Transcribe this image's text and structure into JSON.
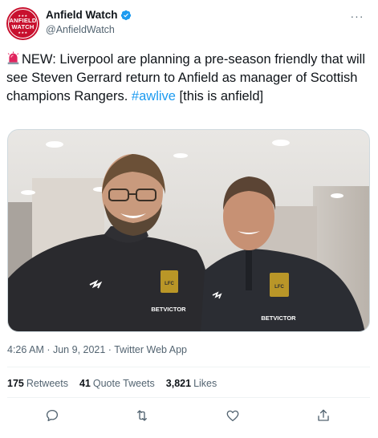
{
  "author": {
    "display_name": "Anfield Watch",
    "handle": "@AnfieldWatch",
    "avatar_text_top": "ANFIELD",
    "avatar_text_bottom": "WATCH",
    "avatar_color": "#c8102e",
    "verified_icon": "verified-badge-icon"
  },
  "tweet": {
    "prefix": "NEW: Liverpool are planning a pre-season friendly that will see Steven Gerrard return to Anfield as manager of Scottish champions Rangers. ",
    "hashtag": "#awlive",
    "suffix": " [this is anfield]",
    "emoji_icon": "police-siren-icon"
  },
  "photo": {
    "kind": "photo-two-men-smiling",
    "left_badge": "BETVICTOR",
    "right_badge": "BETVICTOR",
    "left_chest": "LFC",
    "right_chest": "LFC"
  },
  "meta": {
    "time": "4:26 AM",
    "separator": " · ",
    "date": "Jun 9, 2021",
    "app": "Twitter Web App"
  },
  "stats": {
    "retweets_count": "175",
    "retweets_label": "Retweets",
    "quotes_count": "41",
    "quotes_label": "Quote Tweets",
    "likes_count": "3,821",
    "likes_label": "Likes"
  },
  "colors": {
    "link": "#1d9bf0",
    "secondary_text": "#536471",
    "primary_text": "#0f1419"
  },
  "actions": [
    "reply-icon",
    "retweet-icon",
    "like-icon",
    "share-icon"
  ]
}
